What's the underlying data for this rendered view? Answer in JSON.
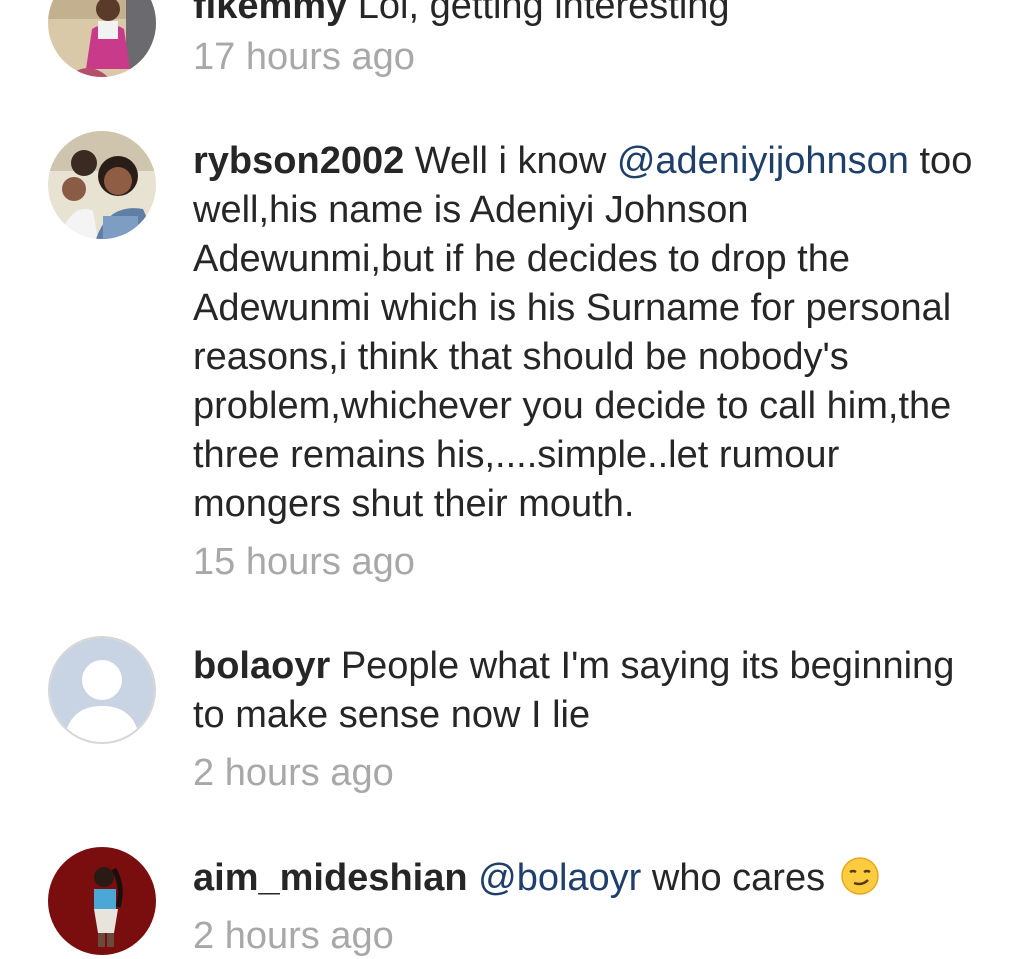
{
  "comments": [
    {
      "username": "fikemmy",
      "text": "Lol, getting interesting",
      "time": "17 hours ago",
      "avatar": "photo-avatar"
    },
    {
      "username": "rybson2002",
      "text_before": "Well i know",
      "mention": "@adeniyijohnson",
      "text_after": "too well,his name is Adeniyi Johnson Adewunmi,but if he decides to drop the Adewunmi which is his Surname for personal reasons,i think that should be nobody's problem,whichever you decide to call him,the three remains his,....simple..let rumour mongers shut their mouth.",
      "time": "15 hours ago",
      "avatar": "photo-avatar"
    },
    {
      "username": "bolaoyr",
      "text": "People what I'm saying its beginning to make sense now I lie",
      "time": "2 hours ago",
      "avatar": "default-avatar"
    },
    {
      "username": "aim_mideshian",
      "mention": "@bolaoyr",
      "text_after": "who cares",
      "emoji": "smirking-face-emoji",
      "time": "2 hours ago",
      "avatar": "photo-avatar"
    }
  ],
  "colors": {
    "text": "#262626",
    "mention": "#1e3f6a",
    "timestamp": "#a8a8a8",
    "background": "#ffffff"
  }
}
